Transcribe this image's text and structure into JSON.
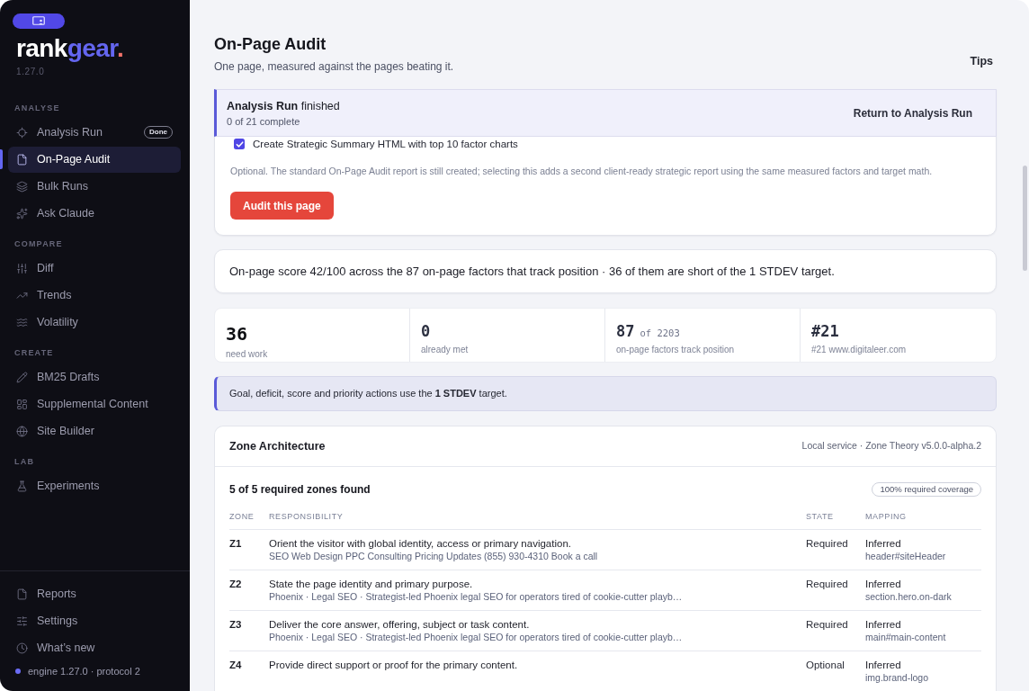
{
  "sidebar": {
    "logo": {
      "primary": "rank",
      "accent": "gear",
      "dot": "."
    },
    "version": "1.27.0",
    "sections": [
      {
        "label": "ANALYSE",
        "items": [
          {
            "label": "Analysis Run",
            "badge": "Done",
            "selected": false
          },
          {
            "label": "On-Page Audit",
            "selected": true
          },
          {
            "label": "Bulk Runs",
            "selected": false
          },
          {
            "label": "Ask Claude",
            "selected": false
          }
        ]
      },
      {
        "label": "COMPARE",
        "items": [
          {
            "label": "Diff",
            "selected": false
          },
          {
            "label": "Trends",
            "selected": false
          },
          {
            "label": "Volatility",
            "selected": false
          }
        ]
      },
      {
        "label": "CREATE",
        "items": [
          {
            "label": "BM25 Drafts",
            "selected": false
          },
          {
            "label": "Supplemental Content",
            "selected": false
          },
          {
            "label": "Site Builder",
            "selected": false
          }
        ]
      },
      {
        "label": "LAB",
        "items": [
          {
            "label": "Experiments",
            "selected": false
          }
        ]
      }
    ],
    "footer_items": [
      {
        "label": "Reports",
        "selected": false
      },
      {
        "label": "Settings",
        "selected": false
      },
      {
        "label": "What’s new",
        "selected": false
      }
    ],
    "status": "engine 1.27.0 · protocol 2"
  },
  "header": {
    "title": "On-Page Audit",
    "subtitle": "One page, measured against the pages beating it.",
    "tips": "Tips"
  },
  "run_panel": {
    "status": "**Analysis Run** finished",
    "count": "0 of 21 complete",
    "return_link": "Return to Analysis Run",
    "option": {
      "label": "Create Strategic Summary HTML with top 10 factor charts",
      "checked": true
    },
    "note": "Optional. The standard On-Page Audit report is still created; selecting this adds a second client-ready strategic report using the same measured factors and target math.",
    "action": "Audit this page"
  },
  "score_summary": "On-page score 42/100 across the 87 on-page factors that track position · 36 of them are short of the 1 STDEV target.",
  "stats": [
    {
      "value": "36",
      "label": "need work",
      "highlight": true
    },
    {
      "value": "0",
      "label": "already met",
      "highlight": false
    },
    {
      "value": "87",
      "total": "of 2203",
      "label": "on-page factors track position",
      "highlight": false
    },
    {
      "value": "#21",
      "label": "#21 www.digitaleer.com",
      "highlight": false
    }
  ],
  "target_note": "Goal, deficit, score and priority actions use the **1 STDEV** target.",
  "zone_panel": {
    "title": "Zone Architecture",
    "meta": "Local service · Zone Theory v5.0.0-alpha.2",
    "summary": "5 of 5 required zones found",
    "coverage": "100% required coverage",
    "columns": [
      "ZONE",
      "RESPONSIBILITY",
      "STATE",
      "MAPPING"
    ],
    "rows": [
      {
        "zone": "Z1",
        "responsibility": "Orient the visitor with global identity, access or primary navigation.",
        "evidence": "SEO Web Design PPC Consulting Pricing Updates (855) 930-4310 Book a call",
        "state": "Required",
        "mapping": "Inferred",
        "selector": "header#siteHeader"
      },
      {
        "zone": "Z2",
        "responsibility": "State the page identity and primary purpose.",
        "evidence": "Phoenix · Legal SEO · Strategist-led Phoenix legal SEO for operators tired of cookie-cutter playb…",
        "state": "Required",
        "mapping": "Inferred",
        "selector": "section.hero.on-dark"
      },
      {
        "zone": "Z3",
        "responsibility": "Deliver the core answer, offering, subject or task content.",
        "evidence": "Phoenix · Legal SEO · Strategist-led Phoenix legal SEO for operators tired of cookie-cutter playb…",
        "state": "Required",
        "mapping": "Inferred",
        "selector": "main#main-content"
      },
      {
        "zone": "Z4",
        "responsibility": "Provide direct support or proof for the primary content.",
        "state": "Optional",
        "mapping": "Inferred",
        "selector": "img.brand-logo"
      }
    ]
  }
}
